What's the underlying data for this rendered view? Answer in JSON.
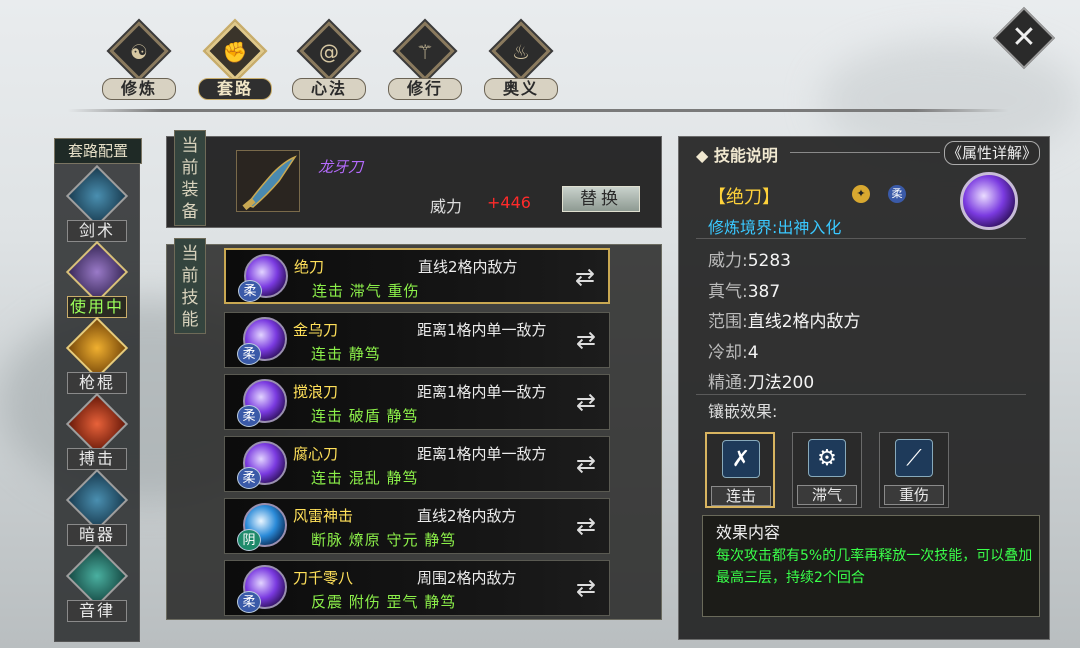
{
  "nav": {
    "tabs": [
      {
        "label": "修炼",
        "icon": "yin-yang-icon"
      },
      {
        "label": "套路",
        "icon": "fist-icon"
      },
      {
        "label": "心法",
        "icon": "spiral-icon"
      },
      {
        "label": "修行",
        "icon": "scroll-icon"
      },
      {
        "label": "奥义",
        "icon": "flame-icon"
      }
    ],
    "active": "套路"
  },
  "sidebar": {
    "title": "套路配置",
    "items": [
      {
        "label": "剑术"
      },
      {
        "label": "使用中"
      },
      {
        "label": "枪棍"
      },
      {
        "label": "搏击"
      },
      {
        "label": "暗器"
      },
      {
        "label": "音律"
      }
    ]
  },
  "equipment": {
    "tag": "当前装备",
    "weapon_name": "龙牙刀",
    "power_label": "威力",
    "power_value": "+446",
    "replace_label": "替换"
  },
  "skills": {
    "tag": "当前技能",
    "list": [
      {
        "name": "绝刀",
        "range": "直线2格内敌方",
        "tags": "连击  滞气  重伤",
        "badge": "柔"
      },
      {
        "name": "金乌刀",
        "range": "距离1格内单一敌方",
        "tags": "连击  静笃",
        "badge": "柔"
      },
      {
        "name": "搅浪刀",
        "range": "距离1格内单一敌方",
        "tags": "连击  破盾  静笃",
        "badge": "柔"
      },
      {
        "name": "腐心刀",
        "range": "距离1格内单一敌方",
        "tags": "连击  混乱  静笃",
        "badge": "柔"
      },
      {
        "name": "风雷神击",
        "range": "直线2格内敌方",
        "tags": "断脉  燎原  守元  静笃",
        "badge": "阴"
      },
      {
        "name": "刀千零八",
        "range": "周围2格内敌方",
        "tags": "反震  附伤  罡气  静笃",
        "badge": "柔"
      }
    ]
  },
  "detail": {
    "title": "技能说明",
    "attr_button": "属性详解",
    "skill_title": "【绝刀】",
    "badge_rou": "柔",
    "realm": "修炼境界:出神入化",
    "stats": [
      {
        "key": "威力:",
        "value": "5283"
      },
      {
        "key": "真气:",
        "value": "387"
      },
      {
        "key": "范围:",
        "value": "直线2格内敌方"
      },
      {
        "key": "冷却:",
        "value": "4"
      },
      {
        "key": "精通:",
        "value": "刀法200"
      }
    ],
    "inlay_label": "镶嵌效果:",
    "inlays": [
      {
        "name": "连击",
        "icon": "crossed-arrows-icon"
      },
      {
        "name": "滞气",
        "icon": "gear-cloud-icon"
      },
      {
        "name": "重伤",
        "icon": "blood-drop-icon"
      }
    ],
    "effect_title": "效果内容",
    "effect_text": "每次攻击都有5%的几率再释放一次技能，可以叠加最高三层，持续2个回合"
  }
}
